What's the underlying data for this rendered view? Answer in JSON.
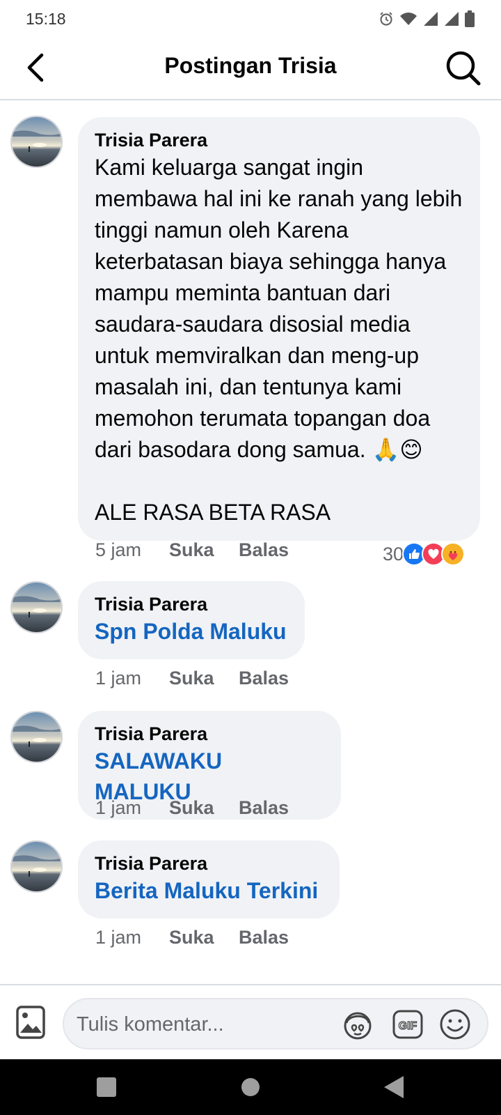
{
  "status_bar": {
    "time": "15:18",
    "icons": [
      "alarm-icon",
      "wifi-icon",
      "signal-icon",
      "signal-icon",
      "battery-icon"
    ]
  },
  "header": {
    "title": "Postingan Trisia",
    "back_icon": "back-arrow-icon",
    "search_icon": "search-icon"
  },
  "comments": [
    {
      "author": "Trisia Parera",
      "text": "Kami keluarga sangat ingin membawa hal ini ke ranah yang lebih tinggi namun oleh Karena keterbatasan biaya sehingga hanya mampu meminta bantuan dari saudara-saudara disosial media untuk memviralkan dan meng-up masalah ini, dan tentunya kami memohon terumata topangan doa dari basodara dong samua. 🙏😊\n\nALE RASA BETA RASA",
      "time": "5 jam",
      "like_label": "Suka",
      "reply_label": "Balas",
      "reaction_count": "30",
      "reactions": [
        "like-icon",
        "love-icon",
        "care-icon"
      ]
    },
    {
      "author": "Trisia Parera",
      "tag": "Spn Polda Maluku",
      "time": "1 jam",
      "like_label": "Suka",
      "reply_label": "Balas"
    },
    {
      "author": "Trisia Parera",
      "tag": "SALAWAKU MALUKU",
      "time": "1 jam",
      "like_label": "Suka",
      "reply_label": "Balas"
    },
    {
      "author": "Trisia Parera",
      "tag": "Berita Maluku Terkini",
      "time": "1 jam",
      "like_label": "Suka",
      "reply_label": "Balas"
    }
  ],
  "composer": {
    "placeholder": "Tulis komentar...",
    "icons": [
      "photo-icon",
      "avatar-sticker-icon",
      "gif-icon",
      "emoji-icon"
    ]
  },
  "colors": {
    "link": "#1565c0",
    "bubble": "#f0f2f5",
    "like_blue": "#1877f2",
    "love_red": "#f33e58",
    "care_yellow": "#f7b125"
  }
}
